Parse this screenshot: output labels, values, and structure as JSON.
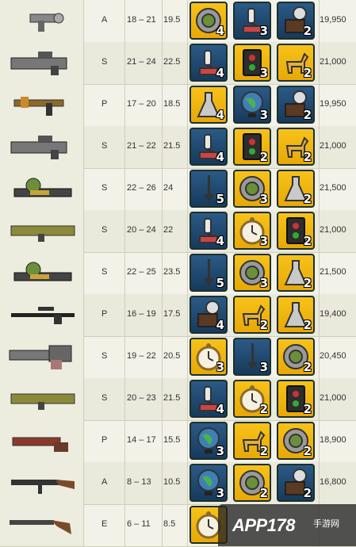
{
  "rows": [
    {
      "weapon_icon": "alien-blaster-icon",
      "rarity": "A",
      "damage": "18 – 21",
      "avg": "19.5",
      "price": "19,950",
      "items": [
        {
          "icon": "gear-icon",
          "bg": "gold",
          "qty": "4"
        },
        {
          "icon": "microscope-icon",
          "bg": "blue",
          "qty": "3"
        },
        {
          "icon": "lamp-icon",
          "bg": "blue",
          "qty": "2"
        }
      ]
    },
    {
      "weapon_icon": "gatling-laser-icon",
      "rarity": "S",
      "damage": "21 – 24",
      "avg": "22.5",
      "price": "21,000",
      "items": [
        {
          "icon": "microscope-icon",
          "bg": "blue",
          "qty": "4"
        },
        {
          "icon": "circuit-board-icon",
          "bg": "gold",
          "qty": "3"
        },
        {
          "icon": "toy-horse-icon",
          "bg": "gold",
          "qty": "2"
        }
      ]
    },
    {
      "weapon_icon": "plasma-pistol-icon",
      "rarity": "P",
      "damage": "17 – 20",
      "avg": "18.5",
      "price": "19,950",
      "items": [
        {
          "icon": "flask-icon",
          "bg": "gold",
          "qty": "4"
        },
        {
          "icon": "globe-icon",
          "bg": "blue",
          "qty": "3"
        },
        {
          "icon": "lamp-icon",
          "bg": "blue",
          "qty": "2"
        }
      ]
    },
    {
      "weapon_icon": "gatling-laser-icon",
      "rarity": "S",
      "damage": "21 – 22",
      "avg": "21.5",
      "price": "21,000",
      "items": [
        {
          "icon": "microscope-icon",
          "bg": "blue",
          "qty": "4"
        },
        {
          "icon": "circuit-board-icon",
          "bg": "gold",
          "qty": "2"
        },
        {
          "icon": "toy-horse-icon",
          "bg": "gold",
          "qty": "2"
        }
      ]
    },
    {
      "weapon_icon": "fat-man-icon",
      "rarity": "S",
      "damage": "22 – 26",
      "avg": "24",
      "price": "21,500",
      "items": [
        {
          "icon": "shovel-icon",
          "bg": "blue",
          "qty": "5"
        },
        {
          "icon": "gear-icon",
          "bg": "gold",
          "qty": "3"
        },
        {
          "icon": "flask-icon",
          "bg": "gold",
          "qty": "2"
        }
      ]
    },
    {
      "weapon_icon": "missile-launcher-icon",
      "rarity": "S",
      "damage": "20 – 24",
      "avg": "22",
      "price": "21,000",
      "items": [
        {
          "icon": "microscope-icon",
          "bg": "blue",
          "qty": "4"
        },
        {
          "icon": "pocket-watch-icon",
          "bg": "gold",
          "qty": "3"
        },
        {
          "icon": "circuit-board-icon",
          "bg": "gold",
          "qty": "2"
        }
      ]
    },
    {
      "weapon_icon": "fat-man-icon",
      "rarity": "S",
      "damage": "22 – 25",
      "avg": "23.5",
      "price": "21,500",
      "items": [
        {
          "icon": "shovel-icon",
          "bg": "blue",
          "qty": "5"
        },
        {
          "icon": "gear-icon",
          "bg": "gold",
          "qty": "3"
        },
        {
          "icon": "flask-icon",
          "bg": "gold",
          "qty": "2"
        }
      ]
    },
    {
      "weapon_icon": "sniper-rifle-icon",
      "rarity": "P",
      "damage": "16 – 19",
      "avg": "17.5",
      "price": "19,400",
      "items": [
        {
          "icon": "lamp-icon",
          "bg": "blue",
          "qty": "4"
        },
        {
          "icon": "toy-horse-icon",
          "bg": "gold",
          "qty": "2"
        },
        {
          "icon": "flask-icon",
          "bg": "gold",
          "qty": "2"
        }
      ]
    },
    {
      "weapon_icon": "minigun-icon",
      "rarity": "S",
      "damage": "19 – 22",
      "avg": "20.5",
      "price": "20,450",
      "items": [
        {
          "icon": "pocket-watch-icon",
          "bg": "gold",
          "qty": "3"
        },
        {
          "icon": "shovel-icon",
          "bg": "blue",
          "qty": "3"
        },
        {
          "icon": "gear-icon",
          "bg": "gold",
          "qty": "2"
        }
      ]
    },
    {
      "weapon_icon": "missile-launcher-icon",
      "rarity": "S",
      "damage": "20 – 23",
      "avg": "21.5",
      "price": "21,000",
      "items": [
        {
          "icon": "microscope-icon",
          "bg": "blue",
          "qty": "4"
        },
        {
          "icon": "pocket-watch-icon",
          "bg": "gold",
          "qty": "2"
        },
        {
          "icon": "circuit-board-icon",
          "bg": "gold",
          "qty": "2"
        }
      ]
    },
    {
      "weapon_icon": "flamer-icon",
      "rarity": "P",
      "damage": "14 – 17",
      "avg": "15.5",
      "price": "18,900",
      "items": [
        {
          "icon": "globe-icon",
          "bg": "blue",
          "qty": "3"
        },
        {
          "icon": "toy-horse-icon",
          "bg": "gold",
          "qty": "2"
        },
        {
          "icon": "gear-icon",
          "bg": "gold",
          "qty": "2"
        }
      ]
    },
    {
      "weapon_icon": "assault-rifle-icon",
      "rarity": "A",
      "damage": "8 – 13",
      "avg": "10.5",
      "price": "16,800",
      "items": [
        {
          "icon": "globe-icon",
          "bg": "blue",
          "qty": "3"
        },
        {
          "icon": "gear-icon",
          "bg": "gold",
          "qty": "2"
        },
        {
          "icon": "lamp-icon",
          "bg": "blue",
          "qty": "2"
        }
      ]
    },
    {
      "weapon_icon": "shotgun-icon",
      "rarity": "E",
      "damage": "6 – 11",
      "avg": "8.5",
      "price": "",
      "items": [
        {
          "icon": "pocket-watch-icon",
          "bg": "gold",
          "qty": ""
        }
      ]
    }
  ],
  "watermark": {
    "text": "APP178",
    "sub": "手游网"
  }
}
